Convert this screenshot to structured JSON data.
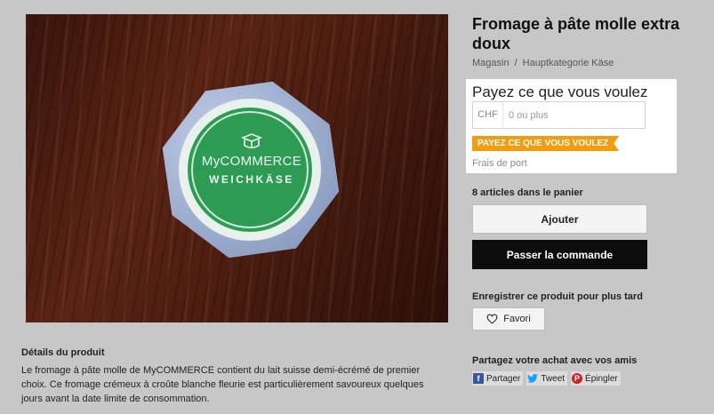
{
  "product": {
    "title": "Fromage à pâte molle extra doux",
    "breadcrumb": [
      "Magasin",
      "Hauptkategorie Käse"
    ],
    "image": {
      "brand_text": "MyCOMMERCE",
      "sub_text": "WEICHKÄSE"
    }
  },
  "pricing": {
    "heading": "Payez ce que vous voulez",
    "currency": "CHF",
    "input_placeholder": "0 ou plus",
    "input_value": "",
    "badge": "PAYEZ CE QUE VOUS VOULEZ",
    "shipping_link": "Frais de port"
  },
  "cart": {
    "count_text": "8 articles dans le panier",
    "add_label": "Ajouter",
    "checkout_label": "Passer la commande"
  },
  "wishlist": {
    "heading": "Enregistrer ce produit pour plus tard",
    "favori_label": "Favori"
  },
  "share": {
    "heading": "Partagez votre achat avec vos amis",
    "buttons": [
      {
        "label": "Partager",
        "icon": "facebook-icon"
      },
      {
        "label": "Tweet",
        "icon": "twitter-icon"
      },
      {
        "label": "Épingler",
        "icon": "pinterest-icon"
      }
    ]
  },
  "details": {
    "heading": "Détails du produit",
    "body": "Le fromage à pâte molle de MyCOMMERCE contient du lait suisse demi-écrémé de premier choix. Ce fromage crémeux à croûte blanche fleurie est particulièrement savoureux quelques jours avant la date limite de consommation."
  },
  "colors": {
    "accent": "#f39c12",
    "checkout": "#0d0d0d",
    "label_green": "#2e9b55"
  }
}
